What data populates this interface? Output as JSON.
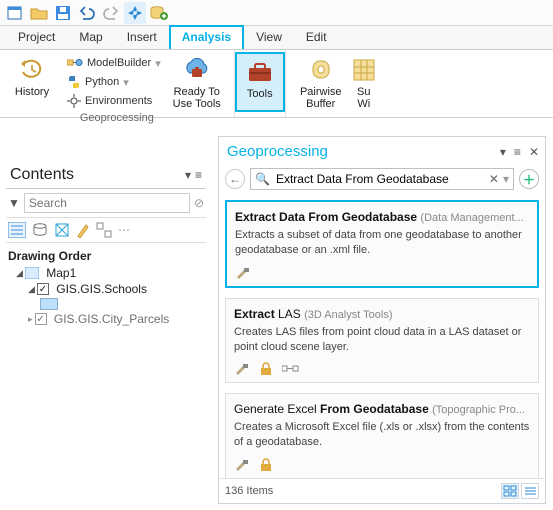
{
  "tabs": {
    "project": "Project",
    "map": "Map",
    "insert": "Insert",
    "analysis": "Analysis",
    "view": "View",
    "edit": "Edit"
  },
  "ribbon": {
    "history": "History",
    "modelbuilder": "ModelBuilder",
    "python": "Python",
    "environments": "Environments",
    "ready": "Ready To\nUse Tools",
    "tools": "Tools",
    "pairwise": "Pairwise\nBuffer",
    "summ": "Su\nWi",
    "grouplabel": "Geoprocessing"
  },
  "contents": {
    "title": "Contents",
    "search_ph": "Search",
    "section": "Drawing Order",
    "map": "Map1",
    "lyr1": "GIS.GIS.Schools",
    "lyr2": "GIS.GIS.City_Parcels"
  },
  "pane": {
    "title": "Geoprocessing",
    "search": "Extract Data From Geodatabase",
    "items": [
      {
        "t1": "Extract Data ",
        "t2": "From Geodatabase",
        "cat": "(Data Management...",
        "desc": "Extracts a subset of data from one geodatabase to another geodatabase or an .xml file.",
        "lock": false,
        "extra": false
      },
      {
        "t1": "Extract ",
        "t2": "LAS",
        "cat": "(3D Analyst Tools)",
        "desc": "Creates LAS files from point cloud data in a LAS dataset or point cloud scene layer.",
        "lock": true,
        "extra": true
      },
      {
        "t1": "Generate Excel ",
        "t2": "From Geodatabase",
        "cat": "(Topographic Pro...",
        "desc": "Creates a Microsoft Excel file (.xls or .xlsx) from the contents of a geodatabase.",
        "lock": true,
        "extra": false
      }
    ],
    "count": "136 Items"
  }
}
